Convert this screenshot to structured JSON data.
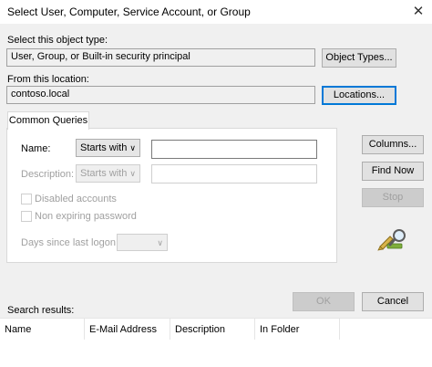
{
  "window": {
    "title": "Select User, Computer, Service Account, or Group",
    "close_glyph": "✕"
  },
  "object_type": {
    "label": "Select this object type:",
    "value": "User, Group, or Built-in security principal",
    "button": "Object Types..."
  },
  "location": {
    "label": "From this location:",
    "value": "contoso.local",
    "button": "Locations..."
  },
  "queries": {
    "tab_label": "Common Queries",
    "name_label": "Name:",
    "name_mode": "Starts with",
    "name_value": "",
    "description_label": "Description:",
    "description_mode": "Starts with",
    "description_value": "",
    "disabled_accounts_label": "Disabled accounts",
    "non_expiring_label": "Non expiring password",
    "days_label": "Days since last logon:",
    "days_value": "",
    "chevron_glyph": "∨"
  },
  "side_buttons": {
    "columns": "Columns...",
    "find_now": "Find Now",
    "stop": "Stop"
  },
  "search_icon": "search-magnifier-icon",
  "search_results_label": "Search results:",
  "dialog_buttons": {
    "ok": "OK",
    "cancel": "Cancel"
  },
  "results_table": {
    "columns": [
      "Name",
      "E-Mail Address",
      "Description",
      "In Folder"
    ]
  }
}
